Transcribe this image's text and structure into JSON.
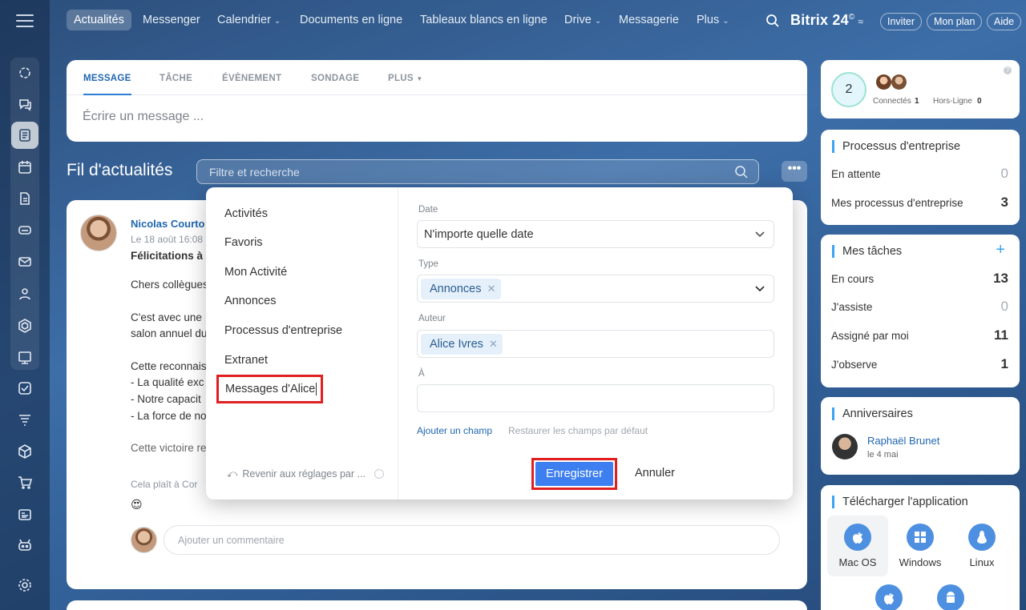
{
  "topnav": {
    "items": [
      "Actualités",
      "Messenger",
      "Calendrier",
      "Documents en ligne",
      "Tableaux blancs en ligne",
      "Drive",
      "Messagerie",
      "Plus"
    ],
    "brand": "Bitrix 24",
    "brand_mark": "©",
    "invite": "Inviter",
    "plan": "Mon plan",
    "help": "Aide"
  },
  "composer": {
    "tabs": [
      "MESSAGE",
      "TÂCHE",
      "ÉVÈNEMENT",
      "SONDAGE",
      "PLUS"
    ],
    "placeholder": "Écrire un message ..."
  },
  "feed": {
    "title": "Fil d'actualités",
    "filter_placeholder": "Filtre et recherche",
    "more": "•••"
  },
  "post": {
    "author": "Nicolas Courto",
    "date": "Le 18 août 16:08",
    "heading": "Félicitations à",
    "lines": [
      "Chers collègues",
      "C'est avec une",
      "salon annuel du",
      "Cette reconnais",
      "- La qualité exc",
      "- Notre capacit",
      "- La force de no",
      "Cette victoire re"
    ],
    "meta": "Cela plaît à   Cor",
    "emoji": "😍",
    "comment_placeholder": "Ajouter un commentaire"
  },
  "online": {
    "count": "2",
    "connected_label": "Connectés",
    "connected": "1",
    "offline_label": "Hors-Ligne",
    "offline": "0"
  },
  "processes": {
    "title": "Processus d'entreprise",
    "rows": [
      {
        "label": "En attente",
        "value": "0"
      },
      {
        "label": "Mes processus d'entreprise",
        "value": "3"
      }
    ]
  },
  "tasks": {
    "title": "Mes tâches",
    "add": "+",
    "rows": [
      {
        "label": "En cours",
        "value": "13"
      },
      {
        "label": "J'assiste",
        "value": "0"
      },
      {
        "label": "Assigné par moi",
        "value": "11"
      },
      {
        "label": "J'observe",
        "value": "1"
      }
    ]
  },
  "birthdays": {
    "title": "Anniversaires",
    "name": "Raphaël Brunet",
    "date": "le 4 mai"
  },
  "download": {
    "title": "Télécharger l'application",
    "apps": [
      "Mac OS",
      "Windows",
      "Linux"
    ]
  },
  "filter_popup": {
    "presets": [
      "Activités",
      "Favoris",
      "Mon Activité",
      "Annonces",
      "Processus d'entreprise",
      "Extranet",
      "Messages d'Alice"
    ],
    "reset": "Revenir aux réglages par ...",
    "date_label": "Date",
    "date_value": "N'importe quelle date",
    "type_label": "Type",
    "type_chip": "Annonces",
    "author_label": "Auteur",
    "author_chip": "Alice Ivres",
    "to_label": "À",
    "add_field": "Ajouter un champ",
    "restore": "Restaurer les champs par défaut",
    "save": "Enregistrer",
    "cancel": "Annuler"
  },
  "colors": {
    "accent": "#3d7ff0",
    "highlight": "#e02020",
    "link": "#2067b0"
  }
}
